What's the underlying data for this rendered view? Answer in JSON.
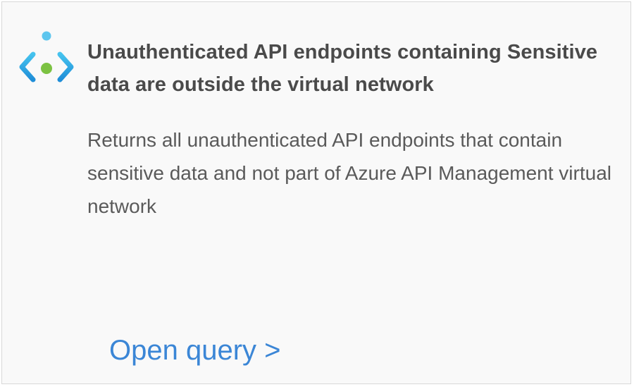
{
  "card": {
    "icon": "api-code-connector-icon",
    "title": "Unauthenticated API endpoints containing Sensitive data are outside the virtual network",
    "description": "Returns all unauthenticated API endpoints that contain sensitive data and not part of Azure API Management virtual network",
    "action_label": "Open query >"
  },
  "colors": {
    "title": "#4a4a4a",
    "description": "#5a5a5a",
    "link": "#3b86d6",
    "icon_cyan": "#35b8e6",
    "icon_green": "#7cc242",
    "card_background": "#f9f9f9"
  }
}
